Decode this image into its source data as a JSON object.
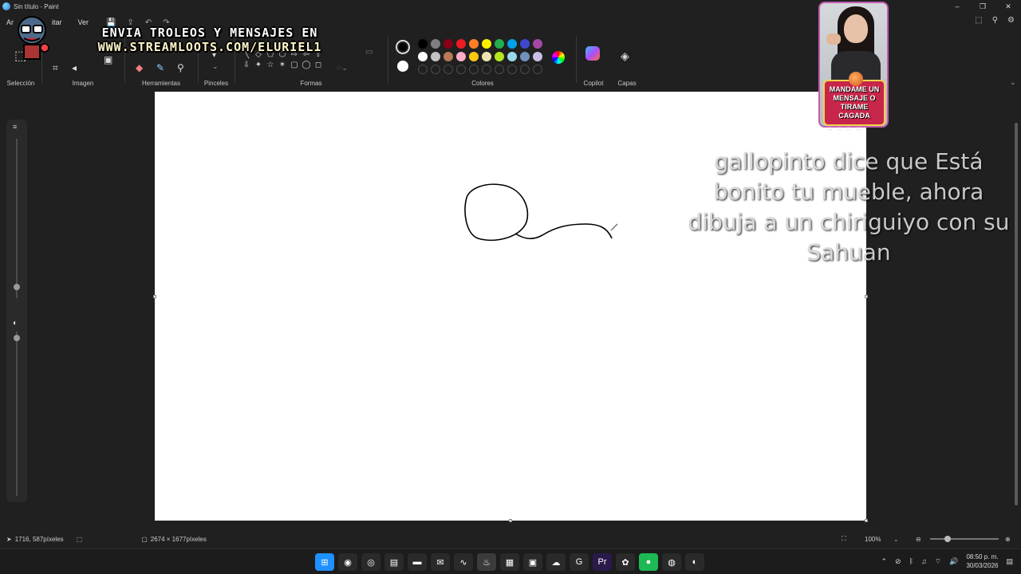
{
  "window": {
    "title": "Sin título - Paint",
    "controls": [
      "–",
      "❐",
      "✕"
    ]
  },
  "menu": {
    "items": [
      "Ar",
      "itar",
      "Ver"
    ],
    "quick_access": [
      "💾",
      "⇪",
      "↶",
      "↷"
    ]
  },
  "ribbon": {
    "groups": [
      "Selección",
      "Imagen",
      "Herramientas",
      "Pinceles",
      "Formas",
      "Colores",
      "Copilot",
      "Capas"
    ],
    "shapes": [
      "╲",
      "◇",
      "⬠",
      "⬡",
      "⇨",
      "⇦",
      "⇧",
      "⇩",
      "✦",
      "☆",
      "✶",
      "▢",
      "◯",
      "◻",
      "◠"
    ],
    "palette_row1": [
      "#000000",
      "#7f7f7f",
      "#880015",
      "#ed1c24",
      "#ff7f27",
      "#fff200",
      "#22b14c",
      "#00a2e8",
      "#3f48cc",
      "#a349a4"
    ],
    "palette_row2": [
      "#ffffff",
      "#c3c3c3",
      "#b97a57",
      "#ffaec9",
      "#ffc90e",
      "#efe4b0",
      "#b5e61d",
      "#99d9ea",
      "#7092be",
      "#c8bfe7"
    ],
    "color1": "#000000",
    "color2": "#ffffff"
  },
  "overlay": {
    "banner_line1": "ENVIA TROLEOS Y MENSAJES EN",
    "banner_line2": "WWW.STREAMLOOTS.COM/ELURIEL1",
    "sign_lines": [
      "MANDAME UN",
      "MENSAJE O",
      "TIRAME CAGADA"
    ],
    "stars": "☆☆☆☆",
    "chat_lines": [
      "gallopinto dice que Está",
      "bonito tu mueble, ahora",
      "dibuja a un chiriguiyo con su",
      "Sahuan"
    ]
  },
  "status": {
    "cursor_position": "1716, 587píxeles",
    "canvas_size": "2674 × 1677píxeles",
    "zoom": "100%",
    "zoom_fraction": 0.25
  },
  "taskbar": {
    "clock_time": "08:50 p. m.",
    "clock_date": "30/03/2026",
    "apps": [
      "⊞",
      "◉",
      "◎",
      "▤",
      "▬",
      "✉",
      "∿",
      "♨",
      "▦",
      "▣",
      "☁",
      "G",
      "Pr",
      "✿",
      "●",
      "◍",
      "◐"
    ]
  }
}
